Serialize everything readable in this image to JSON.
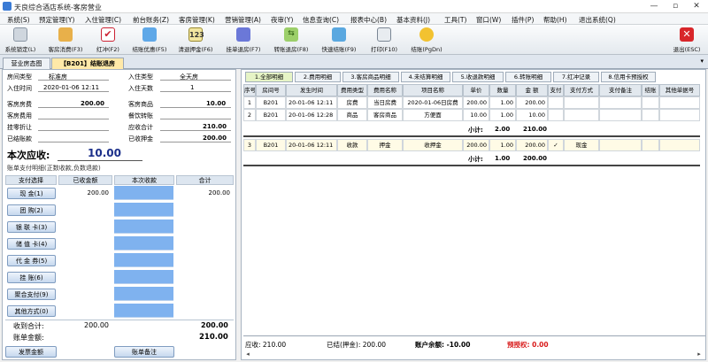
{
  "window": {
    "title": "天良综合酒店系统-客房营业",
    "minimize": "—",
    "restore": "▫",
    "close": "✕"
  },
  "menu": [
    "系统(S)",
    "预定管理(Y)",
    "入住管理(C)",
    "前台账务(Z)",
    "客房管理(K)",
    "营销管理(A)",
    "夜审(Y)",
    "信息查询(C)",
    "报表中心(B)",
    "基本资料(J)",
    "工具(T)",
    "窗口(W)",
    "插件(P)",
    "帮助(H)",
    "退出系统(Q)"
  ],
  "toolbar": {
    "buttons": [
      "系统锁定(L)",
      "客房消费(F3)",
      "红冲(F2)",
      "结账优惠(F5)",
      "清退押金(F6)",
      "挂单退房(F7)",
      "转账退房(F8)",
      "快速结账(F9)",
      "打印(F10)",
      "结账(PgDn)"
    ],
    "exit": "退出(ESC)"
  },
  "page_tabs": [
    "营业房态图",
    "【B201】结账退房"
  ],
  "guest": {
    "room_type_label": "房间类型",
    "room_type": "标准房",
    "checkin_type_label": "入住类型",
    "checkin_type": "全天房",
    "checkin_time_label": "入住时间",
    "checkin_time": "2020-01-06 12:11",
    "days_label": "入住天数",
    "days": "1",
    "room_fee_label": "客房房费",
    "room_fee": "200.00",
    "goods_label": "客房商品",
    "goods": "10.00",
    "consume_label": "客房费用",
    "transfer_label": "餐饮转账",
    "discount_label": "挂零折让",
    "receivable_total_label": "应收合计",
    "receivable_total": "210.00",
    "settled_label": "已结账款",
    "deposit_label": "已收押金",
    "deposit": "200.00",
    "due_label": "本次应收:",
    "due": "10.00"
  },
  "payment": {
    "caption": "账单支付明细(正数收款,负数退款)",
    "headers": [
      "支付选择",
      "已收金额",
      "本次收款",
      "合计"
    ],
    "methods": [
      "现  金(1)",
      "团  购(2)",
      "银 联 卡(3)",
      "储 值 卡(4)",
      "代 金 券(5)",
      "挂  账(6)",
      "聚合支付(9)",
      "其他方式(0)"
    ],
    "rows": [
      {
        "paid": "200.00",
        "total": "200.00"
      }
    ],
    "collected_label": "收到合计:",
    "collected_paid": "200.00",
    "collected_total": "200.00",
    "bill_label": "账单金额:",
    "bill_amount": "210.00",
    "invoice_button": "发票金额",
    "bill_note_button": "账单备注"
  },
  "sub_tabs": [
    "1.全部明细",
    "2.费用明细",
    "3.客房商品明细",
    "4.未结算明细",
    "5.收退款明细",
    "6.转账明细",
    "7.红冲记录",
    "8.信用卡预授权"
  ],
  "table": {
    "headers": [
      "序号",
      "房间号",
      "发生时间",
      "费用类型",
      "费用名称",
      "项目名称",
      "单价",
      "数量",
      "金 额",
      "支付",
      "支付方式",
      "支付备注",
      "结账",
      "其他单据号"
    ],
    "rows1": [
      [
        "1",
        "B201",
        "20-01-06 12:11",
        "房费",
        "当日房费",
        "2020-01-06日房费",
        "200.00",
        "1.00",
        "200.00",
        "",
        "",
        "",
        "",
        ""
      ],
      [
        "2",
        "B201",
        "20-01-06 12:28",
        "商品",
        "客房商品",
        "方便面",
        "10.00",
        "1.00",
        "10.00",
        "",
        "",
        "",
        "",
        ""
      ]
    ],
    "subtotal1": {
      "label": "小计:",
      "qty": "2.00",
      "amount": "210.00"
    },
    "rows2": [
      [
        "3",
        "B201",
        "20-01-06 12:11",
        "收款",
        "押金",
        "收押金",
        "200.00",
        "1.00",
        "200.00",
        "✓",
        "现金",
        "",
        "",
        ""
      ]
    ],
    "subtotal2": {
      "label": "小计:",
      "qty": "1.00",
      "amount": "200.00"
    }
  },
  "footer": {
    "receivable": "应收: 210.00",
    "settled": "已结(押金): 200.00",
    "balance": "账户余额: -10.00",
    "preauth": "预授权: 0.00"
  }
}
